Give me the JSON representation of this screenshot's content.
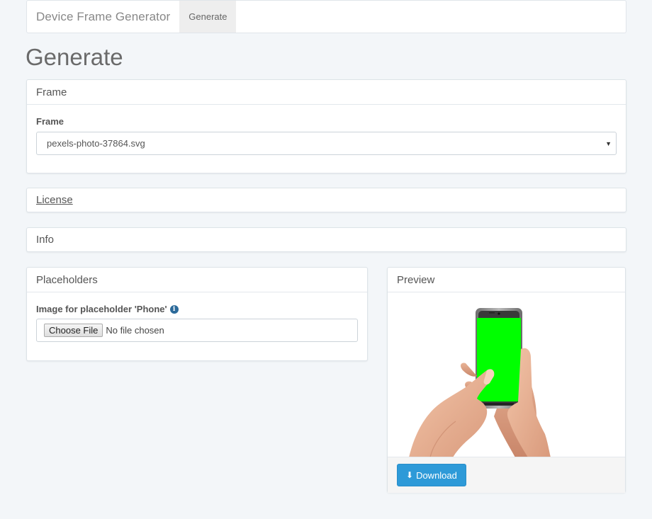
{
  "navbar": {
    "brand": "Device Frame Generator",
    "items": [
      {
        "label": "Generate"
      }
    ]
  },
  "page": {
    "title": "Generate"
  },
  "frame_panel": {
    "heading": "Frame",
    "field_label": "Frame",
    "selected": "pexels-photo-37864.svg"
  },
  "license_panel": {
    "heading": "License"
  },
  "info_panel": {
    "heading": "Info"
  },
  "placeholders_panel": {
    "heading": "Placeholders",
    "field_label": "Image for placeholder 'Phone'",
    "choose_label": "Choose File",
    "file_status": "No file chosen"
  },
  "preview_panel": {
    "heading": "Preview",
    "download_label": "Download",
    "screen_color": "#00ff00",
    "button_color": "#2e9ad8"
  }
}
